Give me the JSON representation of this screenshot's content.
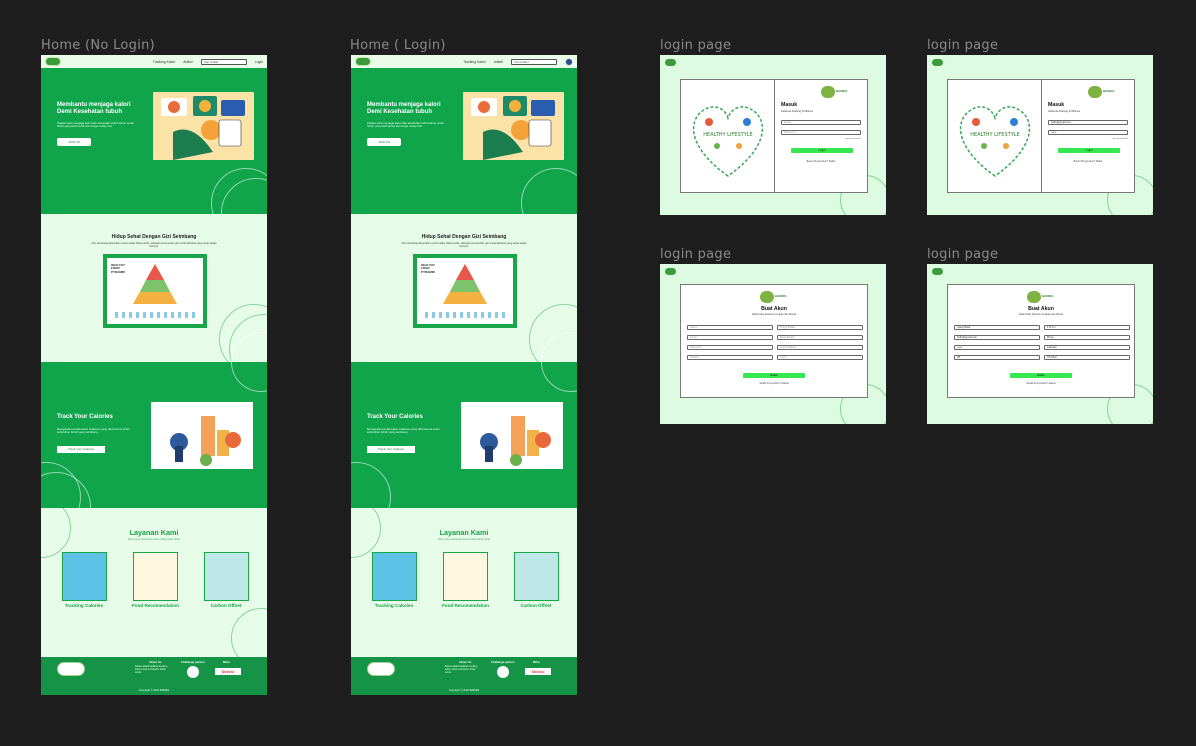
{
  "frames": {
    "home_no_login": "Home (No Login)",
    "home_login": "Home ( Login)",
    "login_1": "login page",
    "login_2": "login page",
    "login_3": "login page",
    "login_4": "login page"
  },
  "nav": {
    "brand": "BARIES",
    "link_1": "Tracking Kalori",
    "link_2": "Artikel",
    "search_placeholder": "Cari Artikel",
    "login_label": "Login"
  },
  "hero": {
    "title": "Membantu menjaga kalori Demi Kesehatan tubuh",
    "subtitle": "Pelajari cara menjaga kalori dan kesehatan tubuh kamu untuk hidup yang lebih sehat dan bugar setiap hari.",
    "button": "JOIN US"
  },
  "gizi": {
    "title": "Hidup Sehat Dengan Gizi Seimbang",
    "subtitle": "Gizi seimbang diperlukan untuk selalu hidup sehat, sebagai pemenuhan gizi untuk aktivitas yang tepat setiap harinya.",
    "pyramid_title": "HEALTHY FOOD PYRAMID"
  },
  "track": {
    "title": "Track Your Calories",
    "subtitle": "Mengetahui jumlah kalori makanan yang dikonsumsi untuk kebutuhan tubuh yang seimbang.",
    "button": "Track Your Calories"
  },
  "layanan": {
    "title": "Layanan Kami",
    "subtitle": "Fitur yang membantu kamu hidup lebih sehat",
    "services": [
      "Tracking Calories",
      "Food Recomendation",
      "Carbon Offset"
    ]
  },
  "footer": {
    "about_h": "About Us",
    "about_t": "Baries adalah aplikasi tracking kalori untuk membantu hidup sehat.",
    "challenge_h": "Challenge partner",
    "mitra_h": "Mitra",
    "mitra_name": "Skilvul",
    "copyright": "Copyright © 2022 BARIES"
  },
  "login": {
    "brand": "BARIES",
    "art_caption": "HEALTHY LIFESTYLE",
    "title": "Masuk",
    "subtitle": "Selamat Datang Di Baries",
    "email_placeholder": "Email",
    "password_placeholder": "Password",
    "email_filled": "hello@gmail.com",
    "password_filled": "••••••",
    "forgot": "Lupa Password?",
    "button": "Login",
    "register_link": "Belum Punya Akun? Daftar"
  },
  "register": {
    "brand": "BARIES",
    "title": "Buat Akun",
    "subtitle": "Isilah Data Secara Lengkap dan Benar",
    "placeholders": [
      "Nama",
      "Tinggi Badan",
      "Email",
      "Berat Badan",
      "Password",
      "Jenis Kelamin",
      "Telepon",
      "Umur"
    ],
    "filled": [
      "Ujang Batik",
      "170 cm",
      "hello@gmail.com",
      "60 kg",
      "••••••",
      "Laki-laki",
      "08",
      "18 tahun"
    ],
    "button": "Daftar",
    "login_link": "Sudah Punya Akun? Masuk"
  },
  "colors": {
    "primary_green": "#10a44b",
    "mint_bg": "#e6fce9",
    "button_green": "#35e84f",
    "canvas_bg": "#1e1e1e"
  }
}
